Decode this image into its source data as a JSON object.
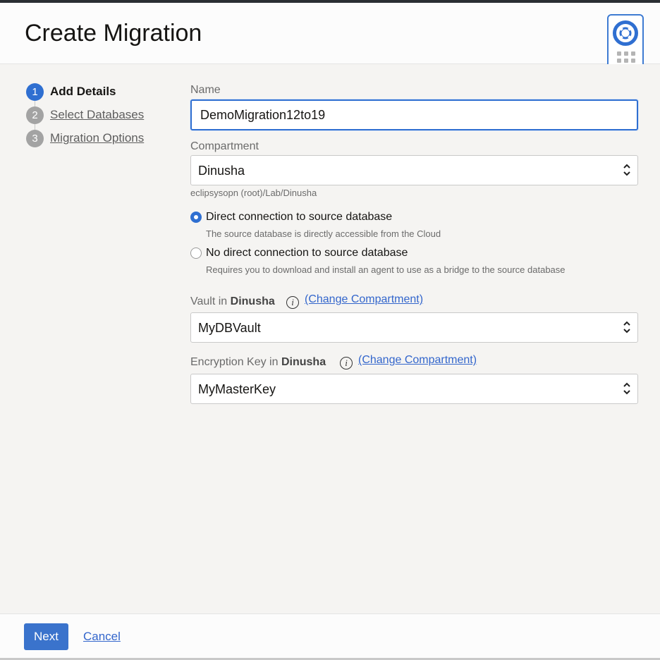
{
  "header": {
    "title": "Create Migration"
  },
  "steps": [
    {
      "number": "1",
      "label": "Add Details",
      "active": true
    },
    {
      "number": "2",
      "label": "Select Databases",
      "active": false
    },
    {
      "number": "3",
      "label": "Migration Options",
      "active": false
    }
  ],
  "form": {
    "name": {
      "label": "Name",
      "value": "DemoMigration12to19"
    },
    "compartment": {
      "label": "Compartment",
      "value": "Dinusha",
      "path": "eclipsysopn (root)/Lab/Dinusha"
    },
    "connection_options": [
      {
        "label": "Direct connection to source database",
        "description": "The source database is directly accessible from the Cloud",
        "checked": true
      },
      {
        "label": "No direct connection to source database",
        "description": "Requires you to download and install an agent to use as a bridge to the source database",
        "checked": false
      }
    ],
    "vault": {
      "label_prefix": "Vault in",
      "label_compartment": "Dinusha",
      "change_link": "(Change Compartment)",
      "value": "MyDBVault"
    },
    "encryption_key": {
      "label_prefix": "Encryption Key in",
      "label_compartment": "Dinusha",
      "change_link": "(Change Compartment)",
      "value": "MyMasterKey"
    },
    "info_icon_glyph": "i"
  },
  "footer": {
    "next_label": "Next",
    "cancel_label": "Cancel"
  },
  "icons": {
    "help": "lifebuoy-icon",
    "apps": "grid-icon",
    "info": "info-icon",
    "select": "chevron-up-down-icon"
  },
  "colors": {
    "accent": "#2f6fd1",
    "primary_button": "#3a73cc",
    "link": "#3366cc"
  }
}
